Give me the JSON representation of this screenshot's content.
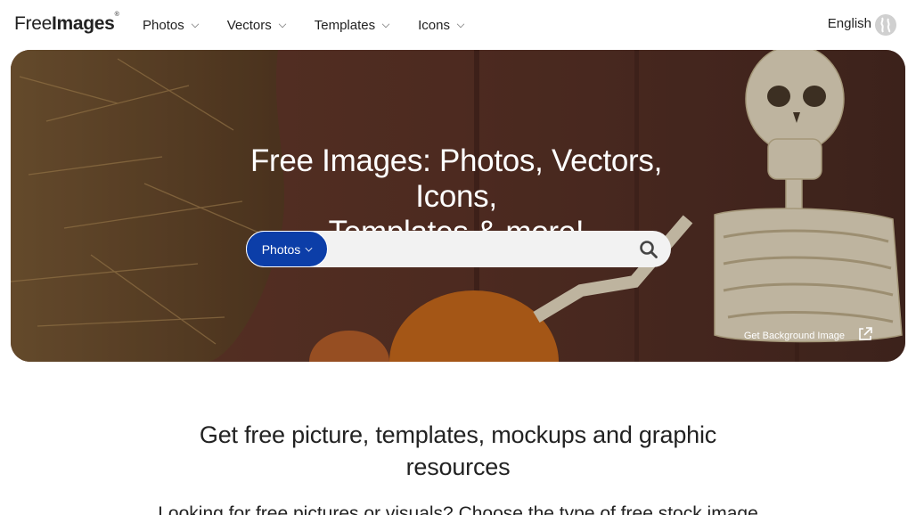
{
  "header": {
    "logo_light": "Free",
    "logo_bold": "Images",
    "logo_mark": "®",
    "nav": [
      {
        "label": "Photos"
      },
      {
        "label": "Vectors"
      },
      {
        "label": "Templates"
      },
      {
        "label": "Icons"
      }
    ],
    "language": "English",
    "language_icon": "globe-icon"
  },
  "hero": {
    "title_line1": "Free Images: Photos, Vectors, Icons,",
    "title_line2": "Templates & more!",
    "search": {
      "type_label": "Photos",
      "placeholder": "",
      "value": "",
      "button_icon": "search-icon"
    },
    "get_background_label": "Get Background Image",
    "get_background_icon": "external-link-icon"
  },
  "content": {
    "headline": "Get free picture, templates, mockups and graphic resources",
    "subtext": "Looking for free pictures or visuals? Choose the type of free stock image"
  },
  "colors": {
    "accent": "#0c3ea8",
    "search_bg": "#f2f2f2",
    "hero_bg": "#5a3328"
  }
}
